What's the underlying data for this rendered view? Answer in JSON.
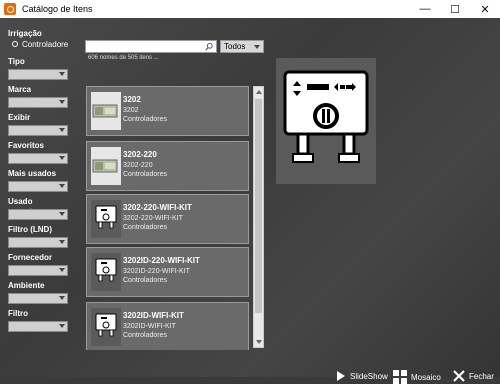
{
  "window": {
    "title": "Catálogo de Itens",
    "minimize": "—",
    "maximize": "☐",
    "close": "✕"
  },
  "sidebar": {
    "irrigacao_label": "Irrigação",
    "radio_label": "Controladore",
    "filters": [
      "Tipo",
      "Marca",
      "Exibir",
      "Favoritos",
      "Mais usados",
      "Usado recentem",
      "Filtro (LND)",
      "Fornecedor",
      "Ambiente",
      "Filtro"
    ]
  },
  "search": {
    "value": "",
    "placeholder": ""
  },
  "todos_select": "Todos",
  "count_text": "606 nomes de 505 itens ...",
  "items": [
    {
      "name": "3202",
      "sub": "3202",
      "category": "Controladores"
    },
    {
      "name": "3202-220",
      "sub": "3202-220",
      "category": "Controladores"
    },
    {
      "name": "3202-220-WIFI-KIT",
      "sub": "3202-220-WIFI-KIT",
      "category": "Controladores"
    },
    {
      "name": "3202ID-220-WIFI-KIT",
      "sub": "3202ID-220-WIFI-KIT",
      "category": "Controladores"
    },
    {
      "name": "3202ID-WIFI-KIT",
      "sub": "3202ID-WIFI-KIT",
      "category": "Controladores"
    }
  ],
  "buttons": {
    "slideshow": "SlideShow",
    "mosaic": "Mosaico",
    "close": "Fechar"
  },
  "icons": {
    "search": "search-icon",
    "slideshow": "play-icon",
    "mosaic": "grid-icon",
    "close": "close-x-icon"
  }
}
